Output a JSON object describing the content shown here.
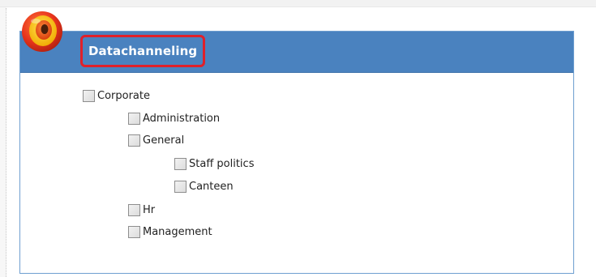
{
  "panel": {
    "title": "Datachanneling",
    "accent_color": "#4a82bf",
    "highlight_color": "#e0202a",
    "logo_icon": "target-ring-icon"
  },
  "tree": {
    "nodes": [
      {
        "label": "Corporate",
        "checked": false,
        "depth": 0
      },
      {
        "label": "Administration",
        "checked": false,
        "depth": 1
      },
      {
        "label": "General",
        "checked": false,
        "depth": 1
      },
      {
        "label": "Staff politics",
        "checked": false,
        "depth": 2
      },
      {
        "label": "Canteen",
        "checked": false,
        "depth": 2
      },
      {
        "label": "Hr",
        "checked": false,
        "depth": 1
      },
      {
        "label": "Management",
        "checked": false,
        "depth": 1
      }
    ]
  }
}
